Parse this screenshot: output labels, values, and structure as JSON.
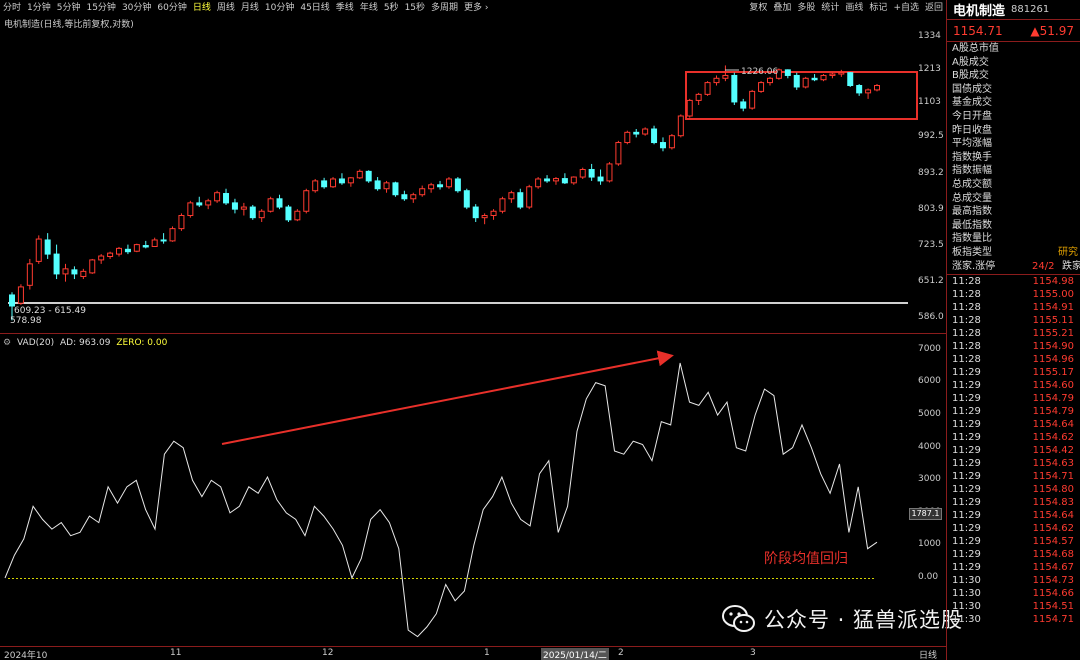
{
  "toolbar": {
    "periods": [
      "分时",
      "1分钟",
      "5分钟",
      "15分钟",
      "30分钟",
      "60分钟",
      "日线",
      "周线",
      "月线",
      "10分钟",
      "45日线",
      "季线",
      "年线",
      "5秒",
      "15秒",
      "多周期",
      "更多 ›"
    ],
    "active_period": "日线",
    "tools": [
      "复权",
      "叠加",
      "多股",
      "统计",
      "画线",
      "标记",
      "+自选",
      "返回"
    ]
  },
  "chart_title": "电机制造(日线,等比前复权,对数)",
  "price_panel": {
    "y_ticks": [
      "1334",
      "1213",
      "1103",
      "992.5",
      "893.2",
      "803.9",
      "723.5",
      "651.2",
      "586.0"
    ],
    "high_label": "1226.06",
    "low_range_label": "609.23 - 615.49",
    "low_label": "578.98"
  },
  "vad_legend": {
    "name": "VAD(20)",
    "ad": "AD: 963.09",
    "zero": "ZERO: 0.00"
  },
  "vad_panel": {
    "y_ticks": [
      "7000",
      "6000",
      "5000",
      "4000",
      "3000",
      "2000",
      "1000",
      "0.00"
    ],
    "current_value": "1787.1"
  },
  "x_axis": {
    "labels": [
      "2024年10",
      "11",
      "12",
      "1",
      "2025/01/14/二",
      "2",
      "3"
    ],
    "type_label": "日线"
  },
  "annotation": "阶段均值回归",
  "watermark": "公众号 · 猛兽派选股",
  "colors": {
    "up": "#ff3b30",
    "down": "#54ffff",
    "accent_red": "#e8302a",
    "zero_line": "#d4d400",
    "axis_border": "#8b1c1c"
  },
  "side_panel": {
    "name": "电机制造",
    "code": "881261",
    "price": "1154.71",
    "change": "▲51.97",
    "fields": [
      "A股总市值",
      "A股成交",
      "B股成交",
      "国债成交",
      "基金成交",
      "今日开盘",
      "昨日收盘",
      "平均涨幅",
      "指数换手",
      "指数振幅",
      "总成交额",
      "总成交量",
      "最高指数",
      "最低指数",
      "指数量比",
      "板指类型"
    ],
    "bottom_row": {
      "label": "涨家.涨停",
      "value": "24/2",
      "right": "跌家"
    },
    "type_right": "研究",
    "ticks": [
      {
        "t": "11:28",
        "p": "1154.98"
      },
      {
        "t": "11:28",
        "p": "1155.00"
      },
      {
        "t": "11:28",
        "p": "1154.91"
      },
      {
        "t": "11:28",
        "p": "1155.11"
      },
      {
        "t": "11:28",
        "p": "1155.21"
      },
      {
        "t": "11:28",
        "p": "1154.90"
      },
      {
        "t": "11:28",
        "p": "1154.96"
      },
      {
        "t": "11:29",
        "p": "1155.17"
      },
      {
        "t": "11:29",
        "p": "1154.60"
      },
      {
        "t": "11:29",
        "p": "1154.79"
      },
      {
        "t": "11:29",
        "p": "1154.79"
      },
      {
        "t": "11:29",
        "p": "1154.64"
      },
      {
        "t": "11:29",
        "p": "1154.62"
      },
      {
        "t": "11:29",
        "p": "1154.42"
      },
      {
        "t": "11:29",
        "p": "1154.63"
      },
      {
        "t": "11:29",
        "p": "1154.71"
      },
      {
        "t": "11:29",
        "p": "1154.80"
      },
      {
        "t": "11:29",
        "p": "1154.83"
      },
      {
        "t": "11:29",
        "p": "1154.64"
      },
      {
        "t": "11:29",
        "p": "1154.62"
      },
      {
        "t": "11:29",
        "p": "1154.57"
      },
      {
        "t": "11:29",
        "p": "1154.68"
      },
      {
        "t": "11:29",
        "p": "1154.67"
      },
      {
        "t": "11:30",
        "p": "1154.73"
      },
      {
        "t": "11:30",
        "p": "1154.66"
      },
      {
        "t": "11:30",
        "p": "1154.51"
      },
      {
        "t": "11:30",
        "p": "1154.71"
      }
    ]
  },
  "chart_data": {
    "type": "candlestick+line",
    "candles_ohlc": [
      [
        620,
        625,
        575,
        600
      ],
      [
        605,
        640,
        602,
        635
      ],
      [
        638,
        690,
        630,
        680
      ],
      [
        685,
        740,
        680,
        732
      ],
      [
        730,
        745,
        690,
        700
      ],
      [
        700,
        720,
        650,
        660
      ],
      [
        660,
        680,
        645,
        670
      ],
      [
        668,
        675,
        650,
        660
      ],
      [
        655,
        670,
        650,
        665
      ],
      [
        662,
        690,
        660,
        688
      ],
      [
        688,
        700,
        680,
        696
      ],
      [
        695,
        705,
        690,
        702
      ],
      [
        700,
        715,
        695,
        712
      ],
      [
        710,
        720,
        700,
        705
      ],
      [
        706,
        722,
        704,
        720
      ],
      [
        718,
        728,
        712,
        715
      ],
      [
        716,
        735,
        715,
        730
      ],
      [
        730,
        745,
        722,
        728
      ],
      [
        728,
        760,
        726,
        755
      ],
      [
        755,
        790,
        750,
        785
      ],
      [
        785,
        820,
        780,
        815
      ],
      [
        815,
        830,
        805,
        810
      ],
      [
        810,
        825,
        800,
        820
      ],
      [
        820,
        845,
        815,
        840
      ],
      [
        838,
        850,
        810,
        815
      ],
      [
        815,
        825,
        790,
        800
      ],
      [
        800,
        815,
        785,
        805
      ],
      [
        805,
        810,
        775,
        780
      ],
      [
        780,
        800,
        770,
        795
      ],
      [
        795,
        830,
        792,
        825
      ],
      [
        825,
        835,
        800,
        805
      ],
      [
        805,
        810,
        770,
        775
      ],
      [
        775,
        800,
        772,
        795
      ],
      [
        795,
        850,
        790,
        845
      ],
      [
        845,
        875,
        840,
        870
      ],
      [
        870,
        878,
        850,
        855
      ],
      [
        855,
        880,
        852,
        875
      ],
      [
        875,
        890,
        860,
        865
      ],
      [
        865,
        880,
        855,
        878
      ],
      [
        878,
        900,
        875,
        895
      ],
      [
        895,
        898,
        865,
        870
      ],
      [
        870,
        880,
        845,
        850
      ],
      [
        850,
        870,
        840,
        865
      ],
      [
        865,
        868,
        830,
        835
      ],
      [
        835,
        845,
        820,
        825
      ],
      [
        825,
        840,
        815,
        835
      ],
      [
        835,
        858,
        830,
        850
      ],
      [
        850,
        865,
        840,
        860
      ],
      [
        860,
        870,
        848,
        855
      ],
      [
        855,
        880,
        850,
        875
      ],
      [
        875,
        880,
        840,
        845
      ],
      [
        845,
        850,
        800,
        805
      ],
      [
        805,
        812,
        770,
        780
      ],
      [
        780,
        790,
        765,
        785
      ],
      [
        785,
        800,
        775,
        795
      ],
      [
        795,
        830,
        790,
        825
      ],
      [
        825,
        845,
        815,
        840
      ],
      [
        840,
        850,
        800,
        805
      ],
      [
        805,
        860,
        800,
        855
      ],
      [
        855,
        880,
        850,
        875
      ],
      [
        875,
        885,
        865,
        870
      ],
      [
        870,
        880,
        860,
        876
      ],
      [
        876,
        890,
        862,
        865
      ],
      [
        865,
        882,
        860,
        880
      ],
      [
        880,
        905,
        875,
        900
      ],
      [
        900,
        915,
        870,
        880
      ],
      [
        880,
        900,
        860,
        870
      ],
      [
        870,
        920,
        866,
        915
      ],
      [
        915,
        980,
        910,
        975
      ],
      [
        975,
        1010,
        970,
        1005
      ],
      [
        1005,
        1015,
        990,
        1000
      ],
      [
        1000,
        1020,
        995,
        1015
      ],
      [
        1015,
        1025,
        970,
        975
      ],
      [
        975,
        990,
        950,
        960
      ],
      [
        960,
        1000,
        955,
        995
      ],
      [
        995,
        1060,
        990,
        1055
      ],
      [
        1055,
        1110,
        1050,
        1105
      ],
      [
        1105,
        1130,
        1090,
        1125
      ],
      [
        1125,
        1170,
        1120,
        1165
      ],
      [
        1165,
        1190,
        1155,
        1180
      ],
      [
        1180,
        1226,
        1170,
        1190
      ],
      [
        1190,
        1200,
        1090,
        1100
      ],
      [
        1100,
        1110,
        1070,
        1080
      ],
      [
        1080,
        1140,
        1075,
        1135
      ],
      [
        1135,
        1170,
        1130,
        1165
      ],
      [
        1165,
        1185,
        1155,
        1180
      ],
      [
        1180,
        1215,
        1175,
        1210
      ],
      [
        1210,
        1212,
        1180,
        1190
      ],
      [
        1190,
        1200,
        1140,
        1150
      ],
      [
        1150,
        1185,
        1145,
        1180
      ],
      [
        1180,
        1195,
        1170,
        1175
      ],
      [
        1175,
        1195,
        1170,
        1190
      ],
      [
        1190,
        1200,
        1180,
        1195
      ],
      [
        1195,
        1210,
        1185,
        1200
      ],
      [
        1200,
        1202,
        1150,
        1155
      ],
      [
        1155,
        1160,
        1120,
        1130
      ],
      [
        1130,
        1145,
        1110,
        1140
      ],
      [
        1140,
        1160,
        1135,
        1155
      ]
    ],
    "vad_values": [
      0,
      700,
      1200,
      2200,
      1800,
      1500,
      1700,
      1300,
      1400,
      1900,
      1700,
      2800,
      2300,
      2800,
      3000,
      2100,
      1500,
      3800,
      4200,
      4000,
      3000,
      2500,
      3000,
      2800,
      2000,
      2200,
      2800,
      2600,
      3100,
      2400,
      2000,
      1800,
      1300,
      2200,
      1900,
      1500,
      1000,
      0,
      600,
      1800,
      2100,
      1700,
      900,
      -1600,
      -1800,
      -1500,
      -1100,
      -200,
      -700,
      -400,
      1000,
      2100,
      2500,
      3100,
      2300,
      1800,
      1600,
      3200,
      3600,
      1400,
      2200,
      4500,
      5500,
      6000,
      5900,
      3900,
      3800,
      4200,
      4100,
      3600,
      4800,
      4700,
      6600,
      5400,
      5300,
      5700,
      5000,
      5400,
      4000,
      3900,
      5000,
      5800,
      5600,
      3800,
      4000,
      4700,
      4000,
      3200,
      2600,
      3500,
      1400,
      2800,
      900,
      1100
    ]
  }
}
